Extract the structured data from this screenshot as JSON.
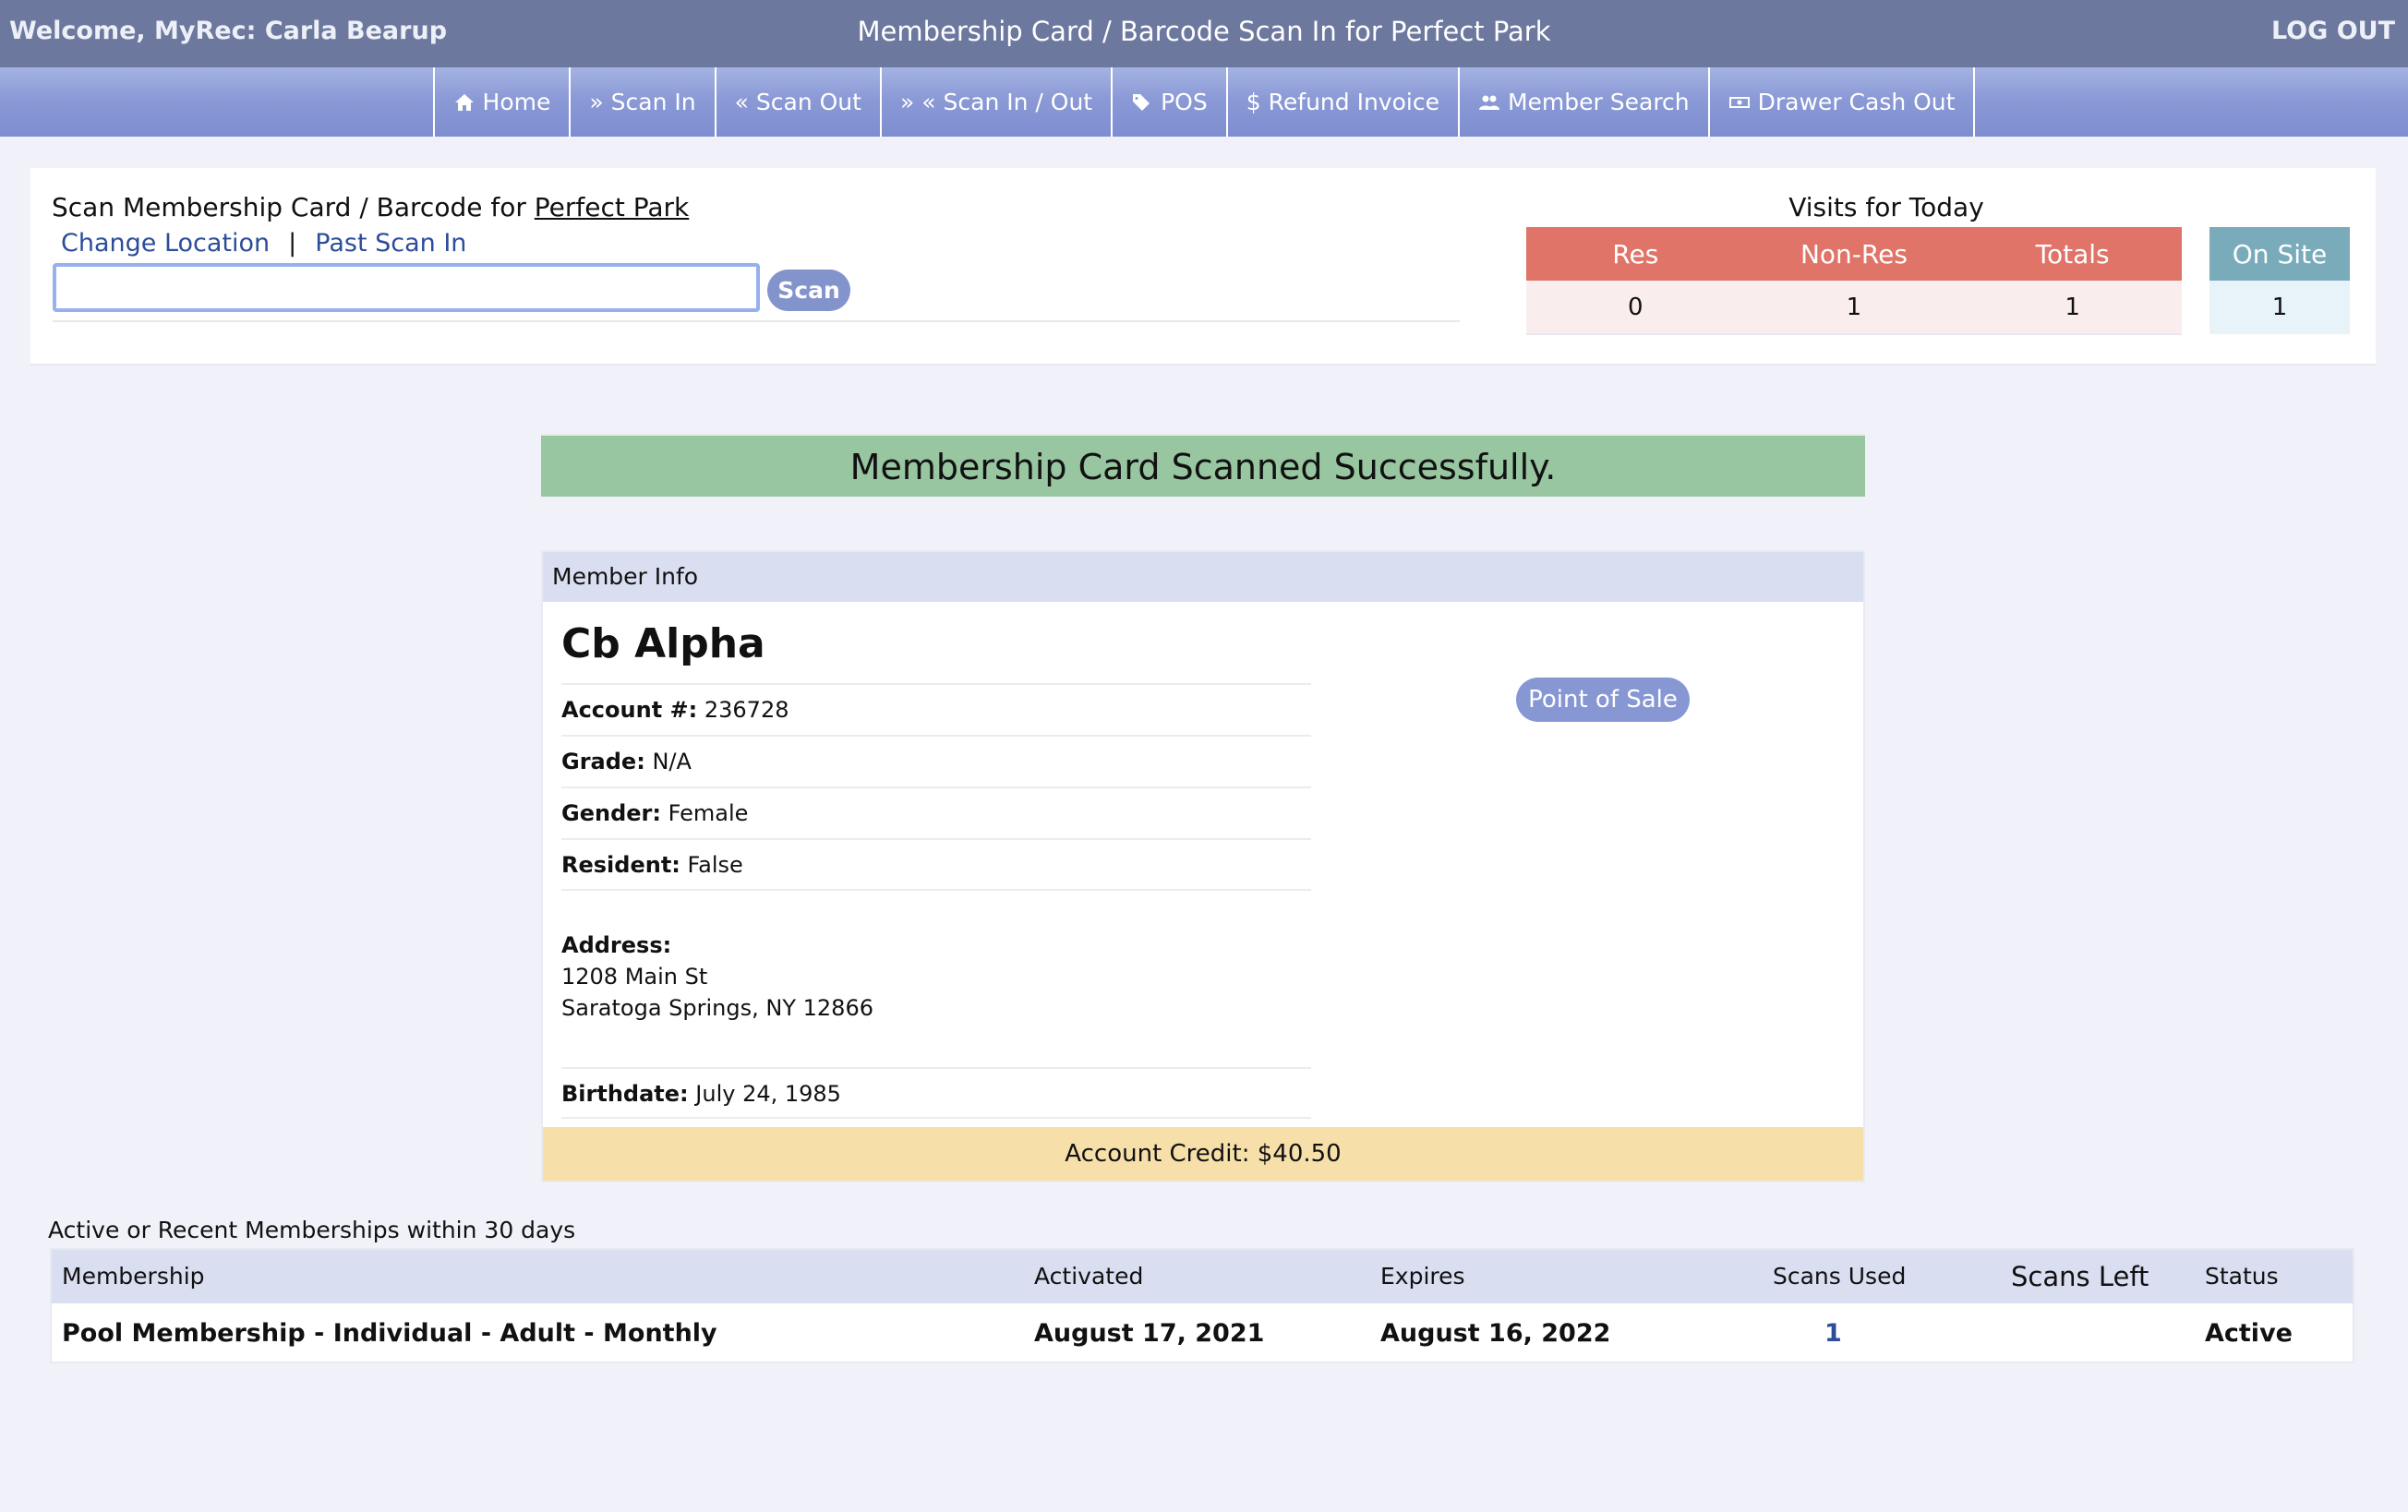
{
  "header": {
    "welcome": "Welcome, MyRec: Carla Bearup",
    "title": "Membership Card / Barcode Scan In for Perfect Park",
    "logout": "LOG OUT"
  },
  "nav": {
    "home": "Home",
    "scan_in": "Scan In",
    "scan_out": "Scan Out",
    "scan_in_out": "Scan In / Out",
    "pos": "POS",
    "refund_invoice": "Refund Invoice",
    "member_search": "Member Search",
    "drawer_cash_out": "Drawer Cash Out"
  },
  "scan": {
    "heading_prefix": "Scan Membership Card / Barcode for ",
    "park": "Perfect Park",
    "change_location": "Change Location",
    "separator": "|",
    "past_scan_in": "Past Scan In",
    "input_value": "",
    "button": "Scan"
  },
  "visits": {
    "title": "Visits for Today",
    "headers": [
      "Res",
      "Non-Res",
      "Totals"
    ],
    "values": [
      "0",
      "1",
      "1"
    ],
    "onsite_header": "On Site",
    "onsite_value": "1"
  },
  "success_message": "Membership Card Scanned Successfully.",
  "member": {
    "section_title": "Member Info",
    "name": "Cb Alpha",
    "account_label": "Account #:",
    "account": "236728",
    "grade_label": "Grade:",
    "grade": "N/A",
    "gender_label": "Gender:",
    "gender": "Female",
    "resident_label": "Resident:",
    "resident": "False",
    "address_label": "Address:",
    "address_line1": "1208 Main St",
    "address_line2": "Saratoga Springs, NY 12866",
    "birthdate_label": "Birthdate:",
    "birthdate": "July 24, 1985",
    "pos_button": "Point of Sale",
    "credit": "Account Credit: $40.50"
  },
  "memberships": {
    "title": "Active or Recent Memberships within 30 days",
    "headers": {
      "membership": "Membership",
      "activated": "Activated",
      "expires": "Expires",
      "scans_used": "Scans Used",
      "scans_left": "Scans Left",
      "status": "Status"
    },
    "rows": [
      {
        "membership": "Pool Membership - Individual - Adult - Monthly",
        "activated": "August 17, 2021",
        "expires": "August 16, 2022",
        "scans_used": "1",
        "scans_left": "",
        "status": "Active"
      }
    ]
  },
  "colors": {
    "topbar": "#6d789f",
    "nav": "#8b9ad6",
    "success": "#97c6a0",
    "visits_header": "#e07468",
    "onsite_header": "#79abbb",
    "credit": "#f7dfa9"
  }
}
